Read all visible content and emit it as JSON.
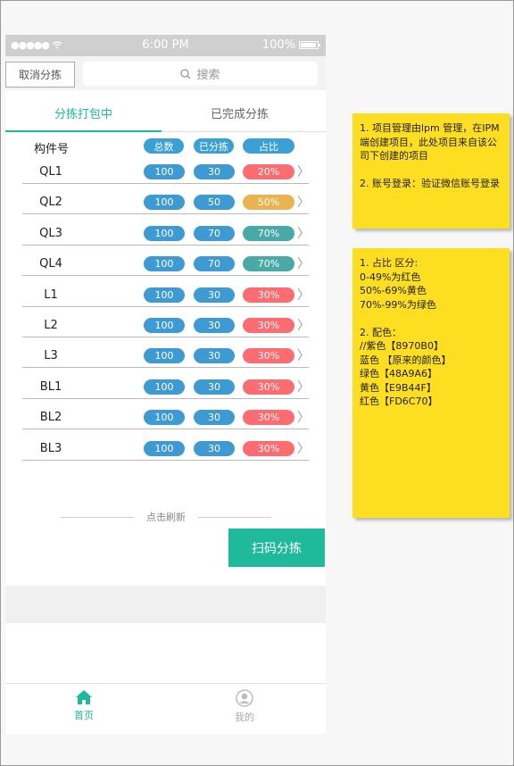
{
  "status_bar": {
    "signal": "●●●●● ",
    "time": "6:00 PM",
    "battery": "100%"
  },
  "search_bar": {
    "cancel_label": "取消分拣",
    "search_placeholder": "搜索"
  },
  "tabs": [
    {
      "label": "分拣打包中"
    },
    {
      "label": "已完成分拣"
    }
  ],
  "table_header": {
    "name_label": "构件号",
    "total_label": "总数",
    "done_label": "已分拣",
    "ratio_label": "占比"
  },
  "rows": [
    {
      "name": "QL1",
      "total": "100",
      "done": "30",
      "ratio": "20%"
    },
    {
      "name": "QL2",
      "total": "100",
      "done": "50",
      "ratio": "50%"
    },
    {
      "name": "QL3",
      "total": "100",
      "done": "70",
      "ratio": "70%"
    },
    {
      "name": "QL4",
      "total": "100",
      "done": "70",
      "ratio": "70%"
    },
    {
      "name": "L1",
      "total": "100",
      "done": "30",
      "ratio": "30%"
    },
    {
      "name": "L2",
      "total": "100",
      "done": "30",
      "ratio": "30%"
    },
    {
      "name": "L3",
      "total": "100",
      "done": "30",
      "ratio": "30%"
    },
    {
      "name": "BL1",
      "total": "100",
      "done": "30",
      "ratio": "30%"
    },
    {
      "name": "BL2",
      "total": "100",
      "done": "30",
      "ratio": "30%"
    },
    {
      "name": "BL3",
      "total": "100",
      "done": "30",
      "ratio": "30%"
    }
  ],
  "refresh_label": "点击刷新",
  "scan_button_label": "扫码分拣",
  "tabbar": {
    "home_label": "首页",
    "me_label": "我的"
  },
  "notes": {
    "note1": "1. 项目管理由lpm 管理，在IPM端创建项目，此处项目来自该公司下创建的项目\n\n2. 账号登录：验证微信账号登录",
    "note2": "1. 占比 区分:\n0-49%为红色\n50%-69%黄色\n70%-99%为绿色\n\n2. 配色：\n//紫色【8970B0】\n蓝色 【原来的颜色】\n绿色【48A9A6】\n黄色【E9B44F】\n红色【FD6C70】"
  },
  "colors": {
    "accent": "#1eb99a",
    "blue": "#3e9ad3",
    "red": "#FD6C70",
    "yellow": "#E9B44F",
    "green": "#48A9A6",
    "note_bg": "#fdde21"
  }
}
